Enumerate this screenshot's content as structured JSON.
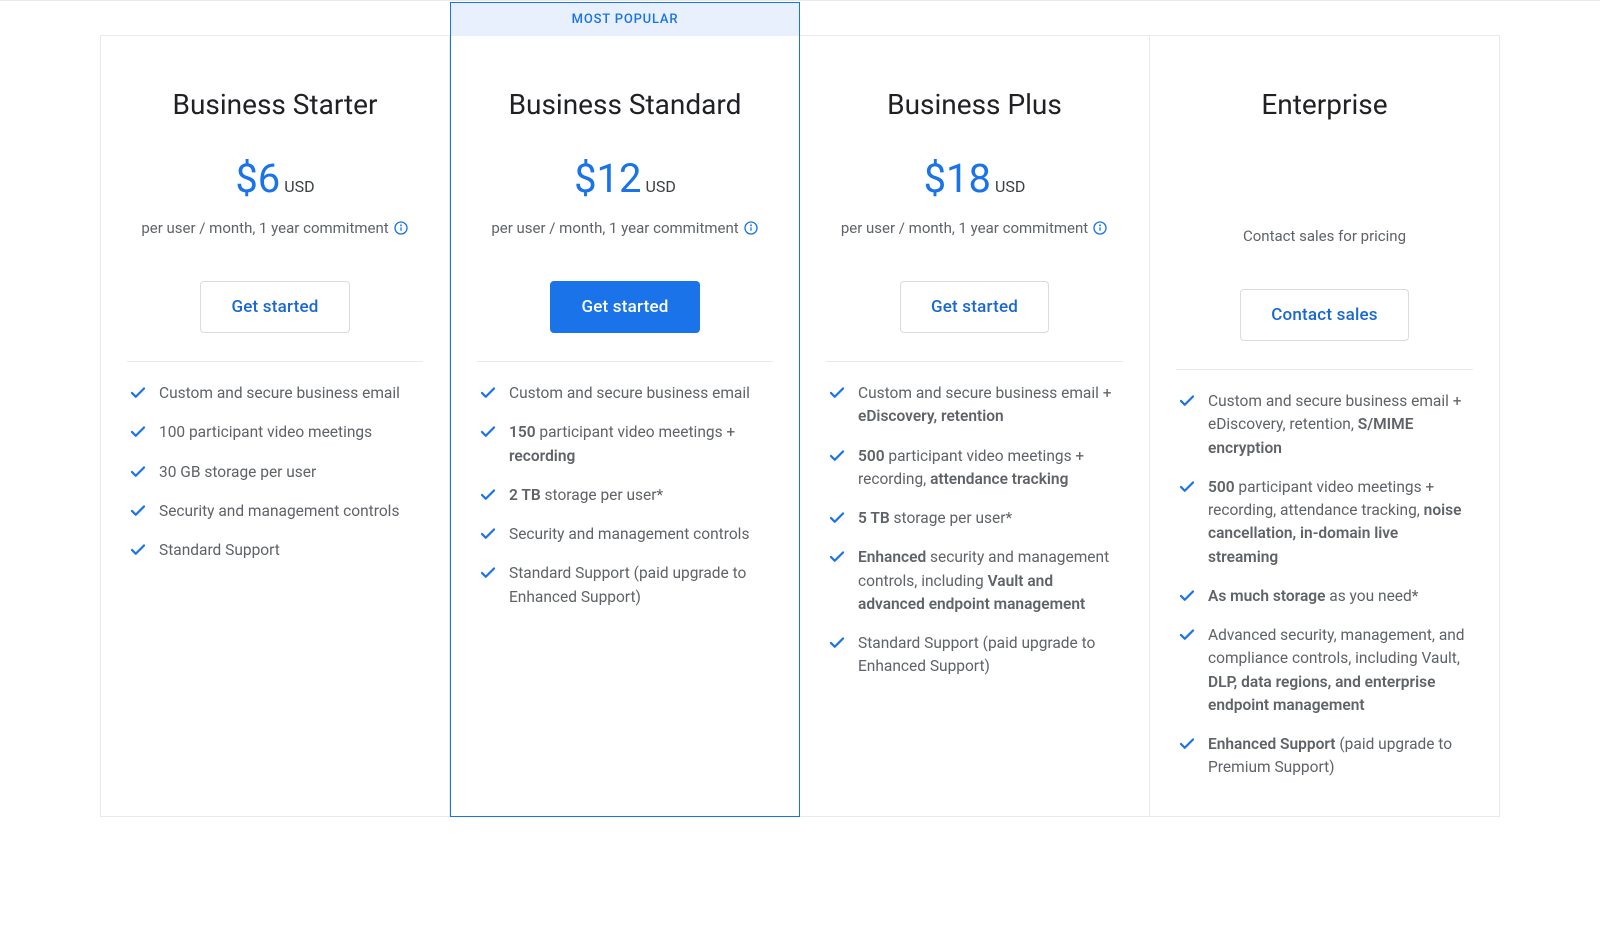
{
  "popular_badge": "MOST POPULAR",
  "plans": [
    {
      "id": "starter",
      "title": "Business Starter",
      "price": "$6",
      "currency": "USD",
      "subtitle": "per user / month, 1 year commitment",
      "show_info": true,
      "popular": false,
      "cta": "Get started",
      "cta_style": "outline",
      "features": [
        "Custom and secure business email",
        "100 participant video meetings",
        "30 GB storage per user",
        "Security and management controls",
        "Standard Support"
      ]
    },
    {
      "id": "standard",
      "title": "Business Standard",
      "price": "$12",
      "currency": "USD",
      "subtitle": "per user / month, 1 year commitment",
      "show_info": true,
      "popular": true,
      "cta": "Get started",
      "cta_style": "fill",
      "features": [
        "Custom and secure business email",
        "<b>150</b> participant video meetings + <b>recording</b>",
        "<b>2 TB</b> storage per user*",
        "Security and management controls",
        "Standard Support (paid upgrade to Enhanced Support)"
      ]
    },
    {
      "id": "plus",
      "title": "Business Plus",
      "price": "$18",
      "currency": "USD",
      "subtitle": "per user / month, 1 year commitment",
      "show_info": true,
      "popular": false,
      "cta": "Get started",
      "cta_style": "outline",
      "features": [
        "Custom and secure business email + <b>eDiscovery, retention</b>",
        "<b>500</b> participant video meetings + recording, <b>attendance tracking</b>",
        "<b>5 TB</b> storage per user*",
        "<b>Enhanced</b> security and management controls, including <b>Vault and advanced endpoint management</b>",
        "Standard Support (paid upgrade to Enhanced Support)"
      ]
    },
    {
      "id": "enterprise",
      "title": "Enterprise",
      "price": null,
      "currency": null,
      "subtitle": "Contact sales for pricing",
      "show_info": false,
      "popular": false,
      "cta": "Contact sales",
      "cta_style": "outline",
      "features": [
        "Custom and secure business email + eDiscovery, retention, <b>S/MIME encryption</b>",
        "<b>500</b> participant video meetings + recording, attendance tracking, <b>noise cancellation, in-domain live streaming</b>",
        "<b>As much storage</b> as you need*",
        "Advanced security, management, and compliance controls, including Vault, <b>DLP, data regions, and enterprise endpoint management</b>",
        "<b>Enhanced Support</b> (paid upgrade to Premium Support)"
      ]
    }
  ]
}
